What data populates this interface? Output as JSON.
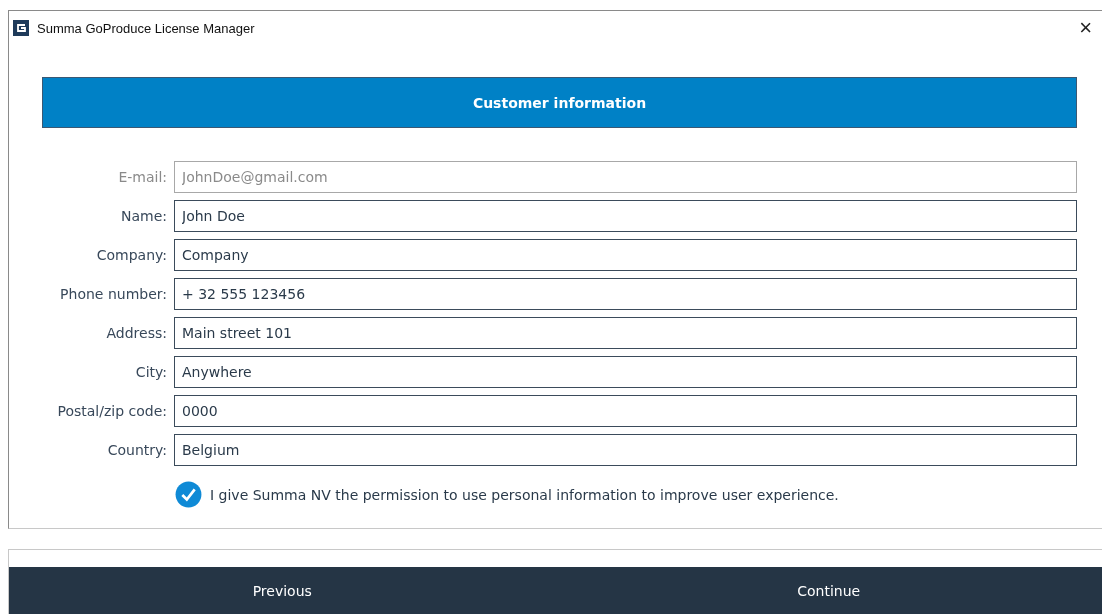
{
  "window": {
    "title": "Summa GoProduce License Manager",
    "close": "×"
  },
  "header": "Customer information",
  "fields": [
    {
      "label": "E-mail:",
      "value": "JohnDoe@gmail.com",
      "disabled": true
    },
    {
      "label": "Name:",
      "value": "John Doe",
      "disabled": false
    },
    {
      "label": "Company:",
      "value": "Company",
      "disabled": false
    },
    {
      "label": "Phone number:",
      "value": "+ 32 555 123456",
      "disabled": false
    },
    {
      "label": "Address:",
      "value": "Main street 101",
      "disabled": false
    },
    {
      "label": "City:",
      "value": "Anywhere",
      "disabled": false
    },
    {
      "label": "Postal/zip code:",
      "value": "0000",
      "disabled": false
    },
    {
      "label": "Country:",
      "value": "Belgium",
      "disabled": false
    }
  ],
  "consent": {
    "label": "I give Summa NV the permission to use personal information to improve user experience.",
    "checked": true
  },
  "buttons": [
    "Previous",
    "Continue"
  ]
}
